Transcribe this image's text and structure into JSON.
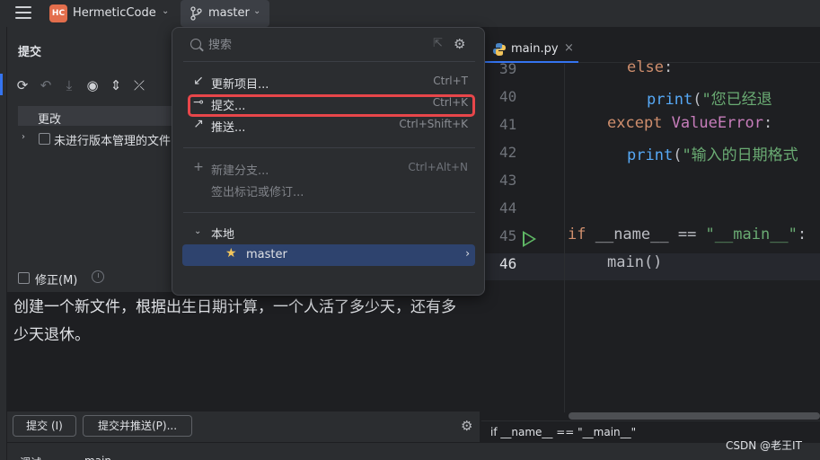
{
  "titlebar": {
    "project_badge": "HC",
    "project_name": "HermeticCode",
    "branch": "master"
  },
  "commit_panel": {
    "title": "提交",
    "changes_label": "更改",
    "unversioned_label": "未进行版本管理的文件",
    "amend_label": "修正(M)",
    "message": "创建一个新文件，根据出生日期计算，一个人活了多少天，还有多少天退休。",
    "commit_button": "提交 (I)",
    "commit_push_button": "提交并推送(P)..."
  },
  "bottom_strip": {
    "tool_label": "调试",
    "config_label": "main"
  },
  "editor": {
    "tab_name": "main.py",
    "lines": [
      {
        "num": "39",
        "indent": 3,
        "tokens": [
          {
            "t": "kw",
            "v": "else"
          },
          {
            "t": "plain",
            "v": ":"
          }
        ]
      },
      {
        "num": "40",
        "indent": 4,
        "tokens": [
          {
            "t": "fn",
            "v": "print"
          },
          {
            "t": "plain",
            "v": "("
          },
          {
            "t": "str",
            "v": "\"您已经退"
          }
        ]
      },
      {
        "num": "41",
        "indent": 2,
        "tokens": [
          {
            "t": "kw",
            "v": "except "
          },
          {
            "t": "cls",
            "v": "ValueError"
          },
          {
            "t": "plain",
            "v": ":"
          }
        ]
      },
      {
        "num": "42",
        "indent": 3,
        "tokens": [
          {
            "t": "fn",
            "v": "print"
          },
          {
            "t": "plain",
            "v": "("
          },
          {
            "t": "str",
            "v": "\"输入的日期格式"
          }
        ]
      },
      {
        "num": "43",
        "indent": 0,
        "tokens": []
      },
      {
        "num": "44",
        "indent": 0,
        "tokens": []
      },
      {
        "num": "45",
        "indent": 0,
        "tokens": [
          {
            "t": "kw",
            "v": "if "
          },
          {
            "t": "plain",
            "v": "__name__ == "
          },
          {
            "t": "str",
            "v": "\"__main__\""
          },
          {
            "t": "plain",
            "v": ":"
          }
        ]
      },
      {
        "num": "46",
        "indent": 2,
        "tokens": [
          {
            "t": "plain",
            "v": "main()"
          }
        ]
      }
    ],
    "breadcrumb": "if __name__ == \"__main__\""
  },
  "popup": {
    "search_placeholder": "搜索",
    "items": [
      {
        "label": "更新项目...",
        "shortcut": "Ctrl+T"
      },
      {
        "label": "提交...",
        "shortcut": "Ctrl+K"
      },
      {
        "label": "推送...",
        "shortcut": "Ctrl+Shift+K"
      },
      {
        "label": "新建分支...",
        "shortcut": "Ctrl+Alt+N"
      },
      {
        "label": "签出标记或修订...",
        "shortcut": ""
      }
    ],
    "group_label": "本地",
    "branch_item": "master"
  },
  "watermark": "CSDN @老王IT",
  "colors": {
    "accent": "#3574f0",
    "highlight_box": "#e8464a",
    "selection": "#2e436e",
    "project_badge": "#e36e4c"
  }
}
